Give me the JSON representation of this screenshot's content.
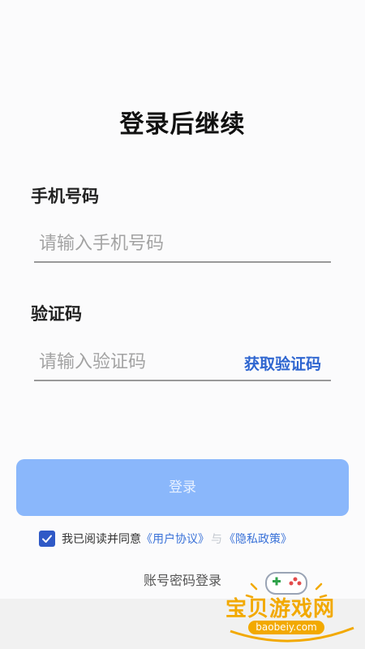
{
  "title": "登录后继续",
  "phone": {
    "label": "手机号码",
    "placeholder": "请输入手机号码"
  },
  "code": {
    "label": "验证码",
    "placeholder": "请输入验证码",
    "get_code": "获取验证码"
  },
  "login_button": "登录",
  "agreement": {
    "checked": true,
    "prefix": "我已阅读并同意",
    "user_agreement": "《用户协议》",
    "separator": "与",
    "privacy_policy": "《隐私政策》"
  },
  "alt_login": "账号密码登录",
  "watermark": {
    "name": "宝贝游戏网",
    "url": "baobeiy.com"
  },
  "colors": {
    "accent": "#2f66d0",
    "button_bg": "#8ab7fb",
    "checkbox": "#2f59c6",
    "watermark": "#f2a900"
  },
  "icons": [
    "check-icon",
    "gamepad-icon"
  ]
}
